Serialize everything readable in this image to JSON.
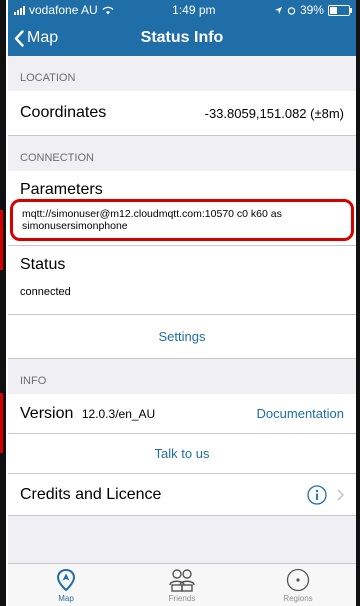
{
  "statusbar": {
    "carrier": "vodafone AU",
    "time": "1:49 pm",
    "battery": "39%",
    "battery_level": 0.39
  },
  "nav": {
    "back_label": "Map",
    "title": "Status Info"
  },
  "location": {
    "header": "LOCATION",
    "coordinates_label": "Coordinates",
    "coordinates_value": "-33.8059,151.082 (±8m)"
  },
  "connection": {
    "header": "CONNECTION",
    "parameters_label": "Parameters",
    "parameters_value": "mqtt://simonuser@m12.cloudmqtt.com:10570 c0 k60 as simonusersimonphone",
    "status_label": "Status",
    "status_value": "connected",
    "settings_label": "Settings"
  },
  "info": {
    "header": "INFO",
    "version_label": "Version",
    "version_value": "12.0.3/en_AU",
    "documentation_label": "Documentation",
    "talk_label": "Talk to us",
    "credits_label": "Credits and Licence"
  },
  "tabs": [
    {
      "label": "Map",
      "icon": "location-pin-icon"
    },
    {
      "label": "Friends",
      "icon": "friends-icon"
    },
    {
      "label": "Regions",
      "icon": "regions-icon"
    }
  ],
  "colors": {
    "accent": "#1f6ea7",
    "highlight": "#d60000"
  }
}
